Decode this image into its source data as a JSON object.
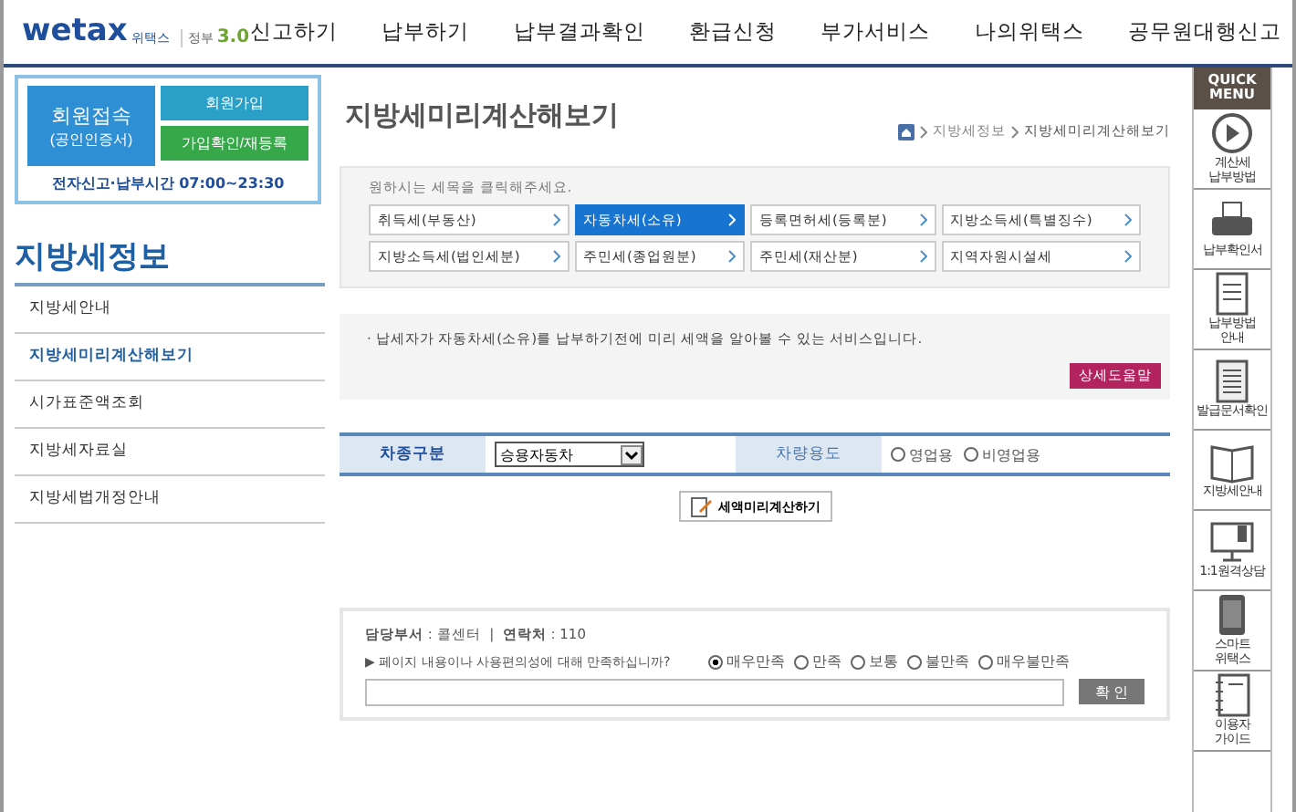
{
  "logo": {
    "name": "wetax",
    "sub": "위택스",
    "gov": "정부",
    "version": "3.0"
  },
  "nav": [
    "신고하기",
    "납부하기",
    "납부결과확인",
    "환급신청",
    "부가서비스",
    "나의위택스",
    "공무원대행신고"
  ],
  "login": {
    "main": "회원접속",
    "sub": "(공인인증서)",
    "join": "회원가입",
    "confirm": "가입확인/재등록",
    "hours": "전자신고·납부시간 07:00~23:30"
  },
  "sidebar": {
    "title": "지방세정보",
    "items": [
      {
        "label": "지방세안내",
        "selected": false
      },
      {
        "label": "지방세미리계산해보기",
        "selected": true
      },
      {
        "label": "시가표준액조회",
        "selected": false
      },
      {
        "label": "지방세자료실",
        "selected": false
      },
      {
        "label": "지방세법개정안내",
        "selected": false
      }
    ]
  },
  "page_title": "지방세미리계산해보기",
  "breadcrumb": [
    "지방세정보",
    "지방세미리계산해보기"
  ],
  "tax_prompt": "원하시는 세목을 클릭해주세요.",
  "tax_types": [
    {
      "label": "취득세(부동산)",
      "selected": false
    },
    {
      "label": "자동차세(소유)",
      "selected": true
    },
    {
      "label": "등록면허세(등록분)",
      "selected": false
    },
    {
      "label": "지방소득세(특별징수)",
      "selected": false
    },
    {
      "label": "지방소득세(법인세분)",
      "selected": false
    },
    {
      "label": "주민세(종업원분)",
      "selected": false
    },
    {
      "label": "주민세(재산분)",
      "selected": false
    },
    {
      "label": "지역자원시설세",
      "selected": false
    }
  ],
  "description": "· 납세자가 자동차세(소유)를 납부하기전에 미리 세액을 알아볼 수 있는 서비스입니다.",
  "help_button": "상세도움말",
  "form": {
    "vehicle_type_label": "차종구분",
    "vehicle_type_value": "승용자동차",
    "usage_label": "차량용도",
    "usage_options": [
      {
        "label": "영업용",
        "selected": false
      },
      {
        "label": "비영업용",
        "selected": false
      }
    ]
  },
  "calc_button": "세액미리계산하기",
  "contact": "**담당부서** : 콜센터  |  **연락처** : 110",
  "survey": {
    "question": "▶ 페이지 내용이나 사용편의성에 대해 만족하십니까?",
    "options": [
      {
        "label": "매우만족",
        "selected": true
      },
      {
        "label": "만족",
        "selected": false
      },
      {
        "label": "보통",
        "selected": false
      },
      {
        "label": "불만족",
        "selected": false
      },
      {
        "label": "매우불만족",
        "selected": false
      }
    ],
    "submit": "확 인"
  },
  "quick_menu": {
    "title": "QUICK\nMENU",
    "items": [
      {
        "kind": "play",
        "label": "계산세\n납부방법"
      },
      {
        "kind": "printer",
        "label": "납부확인서"
      },
      {
        "kind": "memo",
        "label": "납부방법\n안내"
      },
      {
        "kind": "pages",
        "label": "발급문서확인"
      },
      {
        "kind": "book",
        "label": "지방세안내"
      },
      {
        "kind": "monitor",
        "label": "1:1원격상담"
      },
      {
        "kind": "phone",
        "label": "스마트\n위택스"
      },
      {
        "kind": "notebook",
        "label": "이용자\n가이드"
      }
    ]
  }
}
